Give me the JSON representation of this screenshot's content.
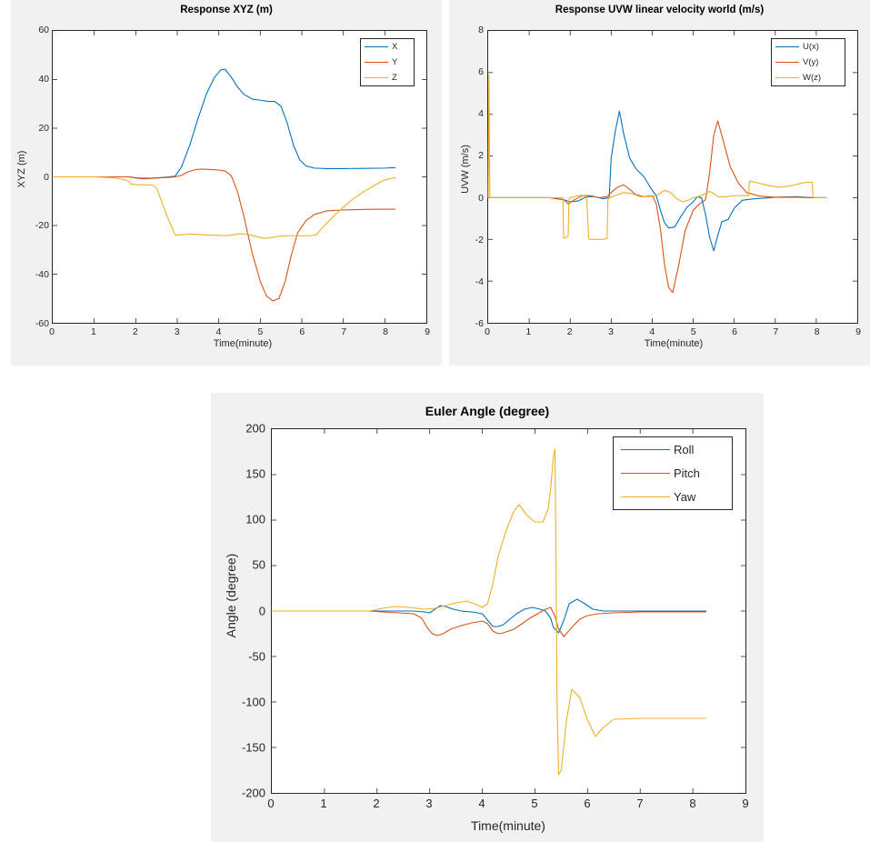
{
  "colors": {
    "series_1": "#0072BD",
    "series_2": "#D95319",
    "series_3": "#EDB120",
    "figure_background": "#F1F1F1",
    "axes_background": "#FFFFFF",
    "axes_line": "#262626",
    "page_background": "#FFFFFF"
  },
  "figures": [
    {
      "name": "response-xyz",
      "title": "Response XYZ (m)",
      "xlabel": "Time(minute)",
      "ylabel": "XYZ (m)",
      "xticks": [
        "0",
        "1",
        "2",
        "3",
        "4",
        "5",
        "6",
        "7",
        "8",
        "9"
      ],
      "yticks": [
        "60",
        "40",
        "20",
        "0",
        "-20",
        "-40",
        "-60"
      ],
      "legend": [
        {
          "label": "X",
          "color": "#0072BD"
        },
        {
          "label": "Y",
          "color": "#D95319"
        },
        {
          "label": "Z",
          "color": "#EDB120"
        }
      ]
    },
    {
      "name": "response-uvw",
      "title": "Response UVW linear velocity world (m/s)",
      "xlabel": "Time(minute)",
      "ylabel": "UVW (m/s)",
      "xticks": [
        "0",
        "1",
        "2",
        "3",
        "4",
        "5",
        "6",
        "7",
        "8",
        "9"
      ],
      "yticks": [
        "8",
        "6",
        "4",
        "2",
        "0",
        "-2",
        "-4",
        "-6"
      ],
      "legend": [
        {
          "label": "U(x)",
          "color": "#0072BD"
        },
        {
          "label": "V(y)",
          "color": "#D95319"
        },
        {
          "label": "W(z)",
          "color": "#EDB120"
        }
      ]
    },
    {
      "name": "euler-angle",
      "title": "Euler Angle (degree)",
      "xlabel": "Time(minute)",
      "ylabel": "Angle (degree)",
      "xticks": [
        "0",
        "1",
        "2",
        "3",
        "4",
        "5",
        "6",
        "7",
        "8",
        "9"
      ],
      "yticks": [
        "200",
        "150",
        "100",
        "50",
        "0",
        "-50",
        "-100",
        "-150",
        "-200"
      ],
      "legend": [
        {
          "label": "Roll",
          "color": "#0072BD"
        },
        {
          "label": "Pitch",
          "color": "#D95319"
        },
        {
          "label": "Yaw",
          "color": "#EDB120"
        }
      ]
    }
  ],
  "chart_data": [
    {
      "type": "line",
      "title": "Response XYZ (m)",
      "xlabel": "Time(minute)",
      "ylabel": "XYZ (m)",
      "xlim": [
        0,
        9
      ],
      "ylim": [
        -60,
        60
      ],
      "xticks": [
        0,
        1,
        2,
        3,
        4,
        5,
        6,
        7,
        8,
        9
      ],
      "yticks": [
        -60,
        -40,
        -20,
        0,
        20,
        40,
        60
      ],
      "grid": false,
      "legend_position": "upper right",
      "series": [
        {
          "name": "X",
          "color": "#0072BD",
          "x": [
            0,
            0.5,
            1,
            1.5,
            1.85,
            2.0,
            2.2,
            2.4,
            2.6,
            2.8,
            2.95,
            3.1,
            3.3,
            3.5,
            3.7,
            3.9,
            4.05,
            4.15,
            4.3,
            4.45,
            4.6,
            4.8,
            5.0,
            5.2,
            5.35,
            5.5,
            5.65,
            5.8,
            5.95,
            6.1,
            6.3,
            6.6,
            7.0,
            7.5,
            8.0,
            8.25
          ],
          "y": [
            0,
            0,
            0,
            0,
            0,
            -0.4,
            -0.6,
            -0.5,
            -0.3,
            0,
            0.3,
            4,
            13,
            24,
            34,
            41,
            44,
            44.3,
            41,
            37,
            34,
            32,
            31.5,
            31,
            31,
            29,
            22,
            13,
            7,
            4.5,
            3.6,
            3.4,
            3.4,
            3.5,
            3.6,
            3.8
          ]
        },
        {
          "name": "Y",
          "color": "#D95319",
          "x": [
            0,
            0.5,
            1,
            1.5,
            1.85,
            2.0,
            2.2,
            2.4,
            2.6,
            2.8,
            2.95,
            3.1,
            3.25,
            3.45,
            3.6,
            3.8,
            4.0,
            4.15,
            4.3,
            4.45,
            4.6,
            4.8,
            5.0,
            5.15,
            5.3,
            5.45,
            5.6,
            5.75,
            5.9,
            6.1,
            6.3,
            6.6,
            7.0,
            7.5,
            8.0,
            8.25
          ],
          "y": [
            0,
            0,
            0,
            0,
            0,
            -0.5,
            -0.8,
            -0.6,
            -0.4,
            -0.2,
            0,
            0.6,
            2.0,
            3.0,
            3.2,
            3.0,
            2.8,
            2.4,
            0.5,
            -6,
            -16,
            -31,
            -43,
            -49,
            -51,
            -50,
            -43,
            -32,
            -23,
            -18,
            -15.5,
            -14,
            -13.6,
            -13.4,
            -13.3,
            -13.3
          ]
        },
        {
          "name": "Z",
          "color": "#EDB120",
          "x": [
            0,
            0.5,
            1,
            1.5,
            1.8,
            1.9,
            2.0,
            2.2,
            2.4,
            2.5,
            2.6,
            2.75,
            2.9,
            2.95,
            3.1,
            3.3,
            3.6,
            3.9,
            4.2,
            4.5,
            4.7,
            4.9,
            5.1,
            5.25,
            5.4,
            5.6,
            5.9,
            6.2,
            6.35,
            6.6,
            6.9,
            7.2,
            7.5,
            7.8,
            8.0,
            8.25
          ],
          "y": [
            0,
            0,
            0,
            -0.4,
            -1.5,
            -3.0,
            -3.2,
            -3.3,
            -3.4,
            -4.5,
            -9,
            -16,
            -22,
            -24,
            -23.8,
            -23.5,
            -23.8,
            -24,
            -24.2,
            -23.4,
            -23.6,
            -24.5,
            -25.3,
            -25.0,
            -24.5,
            -24.2,
            -24.2,
            -24.2,
            -23.8,
            -19,
            -14,
            -9.5,
            -6,
            -3,
            -1.2,
            -0.3
          ]
        }
      ]
    },
    {
      "type": "line",
      "title": "Response UVW linear velocity world (m/s)",
      "xlabel": "Time(minute)",
      "ylabel": "UVW (m/s)",
      "xlim": [
        0,
        9
      ],
      "ylim": [
        -6,
        8
      ],
      "xticks": [
        0,
        1,
        2,
        3,
        4,
        5,
        6,
        7,
        8,
        9
      ],
      "yticks": [
        -6,
        -4,
        -2,
        0,
        2,
        4,
        6,
        8
      ],
      "grid": false,
      "legend_position": "upper right",
      "series": [
        {
          "name": "U(x)",
          "color": "#0072BD",
          "x": [
            0,
            0.5,
            1.0,
            1.5,
            1.85,
            2.0,
            2.2,
            2.4,
            2.6,
            2.8,
            2.95,
            3.0,
            3.1,
            3.2,
            3.3,
            3.45,
            3.6,
            3.8,
            4.0,
            4.1,
            4.2,
            4.3,
            4.4,
            4.55,
            4.7,
            4.85,
            5.0,
            5.1,
            5.2,
            5.3,
            5.4,
            5.5,
            5.6,
            5.7,
            5.85,
            6.0,
            6.2,
            6.5,
            7.0,
            7.5,
            7.9,
            8.25
          ],
          "y": [
            0,
            0,
            0,
            0,
            -0.1,
            -0.2,
            -0.15,
            0.05,
            0.05,
            -0.05,
            0,
            1.9,
            3.2,
            4.15,
            3.1,
            1.9,
            1.4,
            1.0,
            0.35,
            0.1,
            -0.6,
            -1.2,
            -1.45,
            -1.4,
            -0.9,
            -0.45,
            -0.2,
            0.05,
            0,
            -0.8,
            -1.9,
            -2.55,
            -1.8,
            -1.15,
            -1.05,
            -0.5,
            -0.12,
            -0.05,
            0.02,
            0.05,
            0.0,
            0
          ]
        },
        {
          "name": "V(y)",
          "color": "#D95319",
          "x": [
            0,
            0.5,
            1.0,
            1.5,
            1.85,
            1.95,
            2.1,
            2.3,
            2.5,
            2.7,
            2.9,
            3.0,
            3.15,
            3.3,
            3.45,
            3.6,
            3.8,
            4.0,
            4.1,
            4.2,
            4.3,
            4.4,
            4.5,
            4.65,
            4.8,
            5.0,
            5.15,
            5.3,
            5.4,
            5.5,
            5.6,
            5.75,
            5.9,
            6.1,
            6.3,
            6.6,
            7.0,
            7.5,
            7.9,
            8.25
          ],
          "y": [
            0,
            0,
            0,
            0,
            -0.1,
            -0.3,
            -0.1,
            0.1,
            0.1,
            0,
            0.05,
            0.25,
            0.5,
            0.62,
            0.4,
            0.15,
            0.05,
            0.1,
            -0.3,
            -1.5,
            -3.2,
            -4.3,
            -4.55,
            -3.2,
            -1.6,
            -0.6,
            -0.3,
            -0.1,
            1.2,
            3.0,
            3.68,
            2.6,
            1.5,
            0.7,
            0.25,
            0.08,
            0.02,
            0.02,
            0.0,
            0
          ]
        },
        {
          "name": "W(z)",
          "color": "#EDB120",
          "x": [
            0,
            0.02,
            0.04,
            0.5,
            1.0,
            1.5,
            1.82,
            1.84,
            1.9,
            1.95,
            1.97,
            2.0,
            2.2,
            2.4,
            2.45,
            2.47,
            2.6,
            2.8,
            2.9,
            2.92,
            2.95,
            3.1,
            3.3,
            3.5,
            3.7,
            3.9,
            4.1,
            4.3,
            4.45,
            4.6,
            4.75,
            4.9,
            5.0,
            5.2,
            5.4,
            5.5,
            5.6,
            5.8,
            6.0,
            6.2,
            6.35,
            6.37,
            6.5,
            6.8,
            7.1,
            7.4,
            7.7,
            7.9,
            7.92,
            8.0,
            8.25
          ],
          "y": [
            0,
            5.9,
            0,
            0,
            0,
            0,
            0,
            -1.95,
            -1.9,
            -1.85,
            -0.1,
            0,
            0.1,
            0.12,
            -1.9,
            -2.0,
            -2.0,
            -2.0,
            -1.95,
            -0.1,
            0,
            0.1,
            0.25,
            0.2,
            0.05,
            0.05,
            0.1,
            0.35,
            0.25,
            -0.05,
            -0.2,
            -0.1,
            0,
            0.1,
            0.3,
            0.2,
            0.05,
            0.05,
            0.1,
            0.1,
            0.1,
            0.8,
            0.75,
            0.6,
            0.5,
            0.58,
            0.72,
            0.75,
            0.02,
            0,
            0
          ]
        }
      ]
    },
    {
      "type": "line",
      "title": "Euler Angle (degree)",
      "xlabel": "Time(minute)",
      "ylabel": "Angle (degree)",
      "xlim": [
        0,
        9
      ],
      "ylim": [
        -200,
        200
      ],
      "xticks": [
        0,
        1,
        2,
        3,
        4,
        5,
        6,
        7,
        8,
        9
      ],
      "yticks": [
        -200,
        -150,
        -100,
        -50,
        0,
        50,
        100,
        150,
        200
      ],
      "grid": false,
      "legend_position": "upper right",
      "series": [
        {
          "name": "Roll",
          "color": "#0072BD",
          "x": [
            0,
            0.5,
            1.0,
            1.5,
            1.85,
            2.1,
            2.4,
            2.7,
            2.9,
            3.0,
            3.1,
            3.2,
            3.3,
            3.45,
            3.6,
            3.8,
            4.0,
            4.1,
            4.2,
            4.3,
            4.4,
            4.5,
            4.65,
            4.8,
            4.95,
            5.1,
            5.2,
            5.3,
            5.35,
            5.45,
            5.55,
            5.65,
            5.8,
            5.95,
            6.1,
            6.3,
            6.6,
            7.0,
            7.5,
            8.0,
            8.25
          ],
          "y": [
            0,
            0,
            0,
            0,
            0,
            0,
            0,
            0,
            -1,
            -2,
            2,
            6,
            5,
            2,
            0,
            -1,
            -3,
            -10,
            -17,
            -17,
            -15,
            -10,
            -3,
            2,
            4,
            2,
            0,
            -8,
            -18,
            -24,
            -10,
            8,
            13,
            8,
            2,
            0,
            0,
            0,
            0,
            0,
            0
          ]
        },
        {
          "name": "Pitch",
          "color": "#D95319",
          "x": [
            0,
            0.5,
            1.0,
            1.5,
            1.85,
            2.1,
            2.4,
            2.7,
            2.85,
            2.95,
            3.05,
            3.15,
            3.25,
            3.4,
            3.6,
            3.8,
            4.0,
            4.1,
            4.2,
            4.3,
            4.4,
            4.5,
            4.6,
            4.75,
            4.9,
            5.05,
            5.2,
            5.3,
            5.38,
            5.45,
            5.55,
            5.7,
            5.85,
            6.0,
            6.2,
            6.5,
            7.0,
            7.5,
            8.0,
            8.25
          ],
          "y": [
            0,
            0,
            0,
            0,
            0,
            -1,
            -2,
            -3,
            -8,
            -18,
            -25,
            -27,
            -25,
            -20,
            -16,
            -13,
            -11,
            -14,
            -22,
            -25,
            -24,
            -22,
            -20,
            -14,
            -8,
            -3,
            2,
            4,
            -6,
            -20,
            -28,
            -18,
            -9,
            -5,
            -3,
            -2,
            -1,
            -1,
            -1,
            -1
          ]
        },
        {
          "name": "Yaw",
          "color": "#EDB120",
          "x": [
            0,
            0.5,
            1.0,
            1.5,
            1.85,
            2.1,
            2.35,
            2.6,
            2.9,
            3.1,
            3.3,
            3.5,
            3.7,
            3.85,
            4.0,
            4.1,
            4.2,
            4.3,
            4.45,
            4.6,
            4.7,
            4.85,
            5.0,
            5.15,
            5.25,
            5.3,
            5.35,
            5.38,
            5.4,
            5.42,
            5.45,
            5.5,
            5.6,
            5.7,
            5.85,
            6.0,
            6.15,
            6.3,
            6.5,
            7.0,
            7.5,
            8.0,
            8.25
          ],
          "y": [
            0,
            0,
            0,
            0,
            0,
            3,
            5,
            4,
            2,
            3,
            6,
            9,
            11,
            8,
            4,
            8,
            30,
            60,
            88,
            110,
            117,
            105,
            98,
            98,
            112,
            135,
            170,
            178,
            60,
            -100,
            -180,
            -175,
            -120,
            -86,
            -95,
            -120,
            -138,
            -128,
            -119,
            -118,
            -118,
            -118,
            -118
          ]
        }
      ]
    }
  ]
}
